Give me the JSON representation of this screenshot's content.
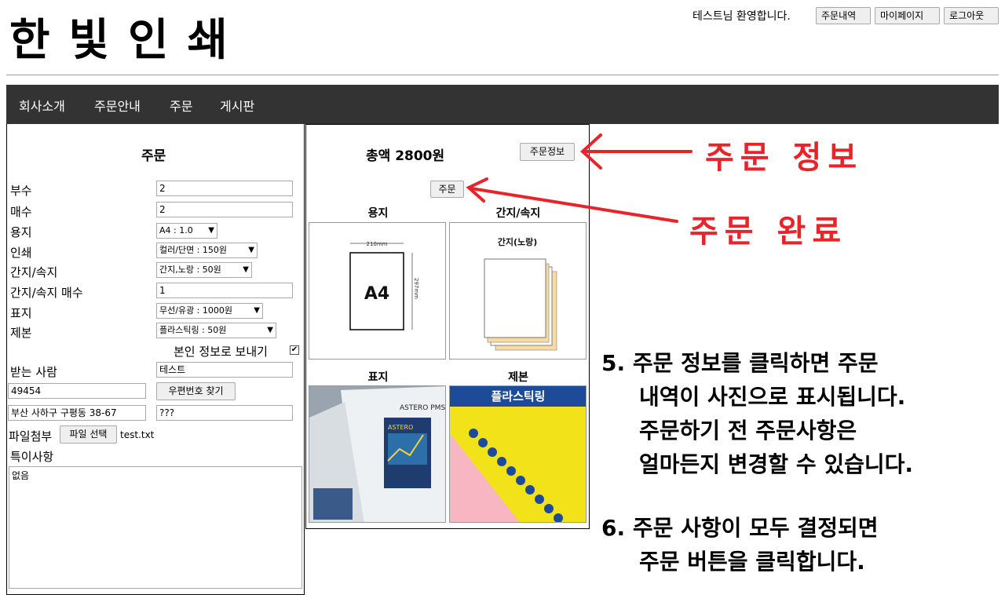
{
  "header": {
    "logo": "한빛인쇄",
    "welcome": "테스트님 환영합니다.",
    "buttons": {
      "orders": "주문내역",
      "mypage": "마이페이지",
      "logout": "로그아웃"
    }
  },
  "nav": {
    "items": [
      "회사소개",
      "주문안내",
      "주문",
      "게시판"
    ]
  },
  "form": {
    "title": "주문",
    "fields": {
      "copies": {
        "label": "부수",
        "value": "2"
      },
      "pages": {
        "label": "매수",
        "value": "2"
      },
      "paper": {
        "label": "용지",
        "value": "A4 : 1.0"
      },
      "print": {
        "label": "인쇄",
        "value": "컬러/단면 : 150원"
      },
      "insert": {
        "label": "간지/속지",
        "value": "간지,노랑 : 50원"
      },
      "insert_count": {
        "label": "간지/속지 매수",
        "value": "1"
      },
      "cover": {
        "label": "표지",
        "value": "무선/유광 : 1000원"
      },
      "binding": {
        "label": "제본",
        "value": "플라스틱링 : 50원"
      }
    },
    "send_self_label": "본인 정보로 보내기",
    "recipient": {
      "label": "받는 사람",
      "value": "테스트"
    },
    "zipcode": "49454",
    "zip_button": "우편번호 찾기",
    "address1": "부산 사하구 구평동 38-67",
    "address2": "???",
    "attach": {
      "label": "파일첨부",
      "button": "파일 선택",
      "filename": "test.txt"
    },
    "notes": {
      "label": "특이사항",
      "value": "없음"
    }
  },
  "summary": {
    "total": "총액 2800원",
    "info_button": "주문정보",
    "order_button": "주문",
    "captions": {
      "paper": "용지",
      "insert": "간지/속지",
      "cover": "표지",
      "binding": "제본"
    },
    "paper_img": {
      "width_label": "210mm",
      "height_label": "297mm",
      "size": "A4"
    },
    "insert_img": {
      "label": "간지(노랑)"
    },
    "cover_img": {
      "text1": "ASTERO PMS",
      "text2": "ASTERO"
    },
    "binding_img": {
      "label": "플라스틱링"
    }
  },
  "annotations": {
    "order_info": "주문 정보",
    "order_done": "주문 완료",
    "step5": [
      "5. 주문 정보를 클릭하면 주문",
      "내역이 사진으로 표시됩니다.",
      "주문하기 전 주문사항은",
      "얼마든지 변경할 수 있습니다."
    ],
    "step6": [
      "6. 주문 사항이 모두 결정되면",
      "주문 버튼을 클릭합니다."
    ]
  },
  "colors": {
    "nav_bg": "#333333",
    "annotation_red": "#e8232a",
    "insert_yellow": "#f7dba0",
    "binding_yellow": "#f2e21a",
    "binding_blue": "#1d4b9a"
  }
}
